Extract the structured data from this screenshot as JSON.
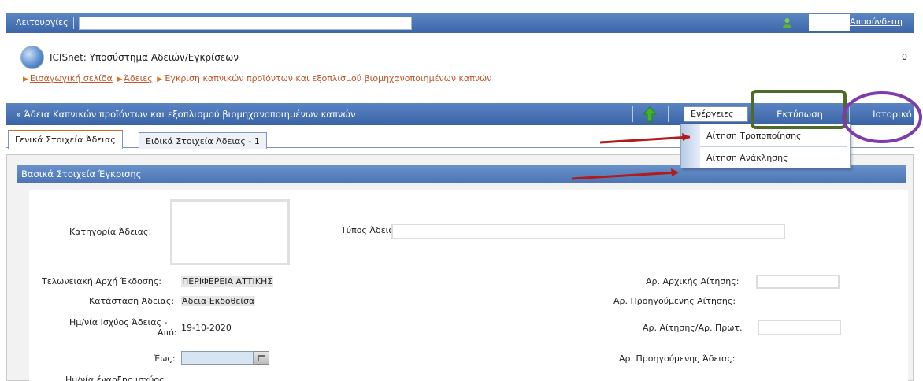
{
  "topbar": {
    "menu_label": "Λειτουργίες",
    "logout": "Αποσύνδεση",
    "user_icon": "user-icon"
  },
  "app": {
    "title": "ICISnet: Υποσύστημα Αδειών/Εγκρίσεων",
    "counter": "0",
    "logo_icon": "globe-icon"
  },
  "breadcrumb": {
    "home": "Εισαγωγική σελίδα",
    "permits": "Άδειες",
    "current": "Έγκριση καπνικών προϊόντων και εξοπλισμού βιομηχανοποιημένων καπνών"
  },
  "section": {
    "title": "» Άδεια Καπνικών προϊόντων και εξοπλισμού βιομηχανοποιημένων καπνών",
    "up_icon": "green-up-arrow-icon",
    "actions_label": "Ενέργειες",
    "print_label": "Εκτύπωση",
    "history_label": "Ιστορικό"
  },
  "tabs": [
    {
      "label": "Γενικά Στοιχεία Άδειας",
      "active": true
    },
    {
      "label": "Ειδικά Στοιχεία Άδειας - 1",
      "active": false
    }
  ],
  "actions_menu": {
    "items": [
      "Αίτηση Τροποποίησης",
      "Αίτηση Ανάκλησης"
    ]
  },
  "panel": {
    "header": "Βασικά Στοιχεία Έγκρισης",
    "fields": {
      "category_label": "Κατηγορία Άδειας:",
      "type_label": "Τύπος Άδειας:",
      "authority_label": "Τελωνειακή Αρχή Έκδοσης:",
      "authority_value": "ΠΕΡΙΦΕΡΕΙΑ ΑΤΤΙΚΗΣ",
      "status_label": "Κατάσταση Άδειας:",
      "status_value": "Άδεια Εκδοθείσα",
      "validity_label_1": "Ημ/νία Ισχύος Άδειας  -",
      "validity_label_2": "Από:",
      "validity_from": "19-10-2020",
      "until_label": "Έως:",
      "start_label": "Ημ/νία έναρξης ισχύος",
      "initial_app_label": "Αρ. Αρχικής Αίτησης:",
      "prev_app_label": "Αρ. Προηγούμενης Αίτησης:",
      "app_protocol_label": "Αρ. Αίτησης/Αρ. Πρωτ.",
      "prev_permit_label": "Αρ. Προηγούμενης Άδειας:"
    }
  },
  "colors": {
    "header_blue": "#3d66a8",
    "breadcrumb_orange": "#c0542a",
    "annot_red": "#b01b1b",
    "annot_green": "#4e6b2a",
    "annot_purple": "#7e3bab"
  }
}
